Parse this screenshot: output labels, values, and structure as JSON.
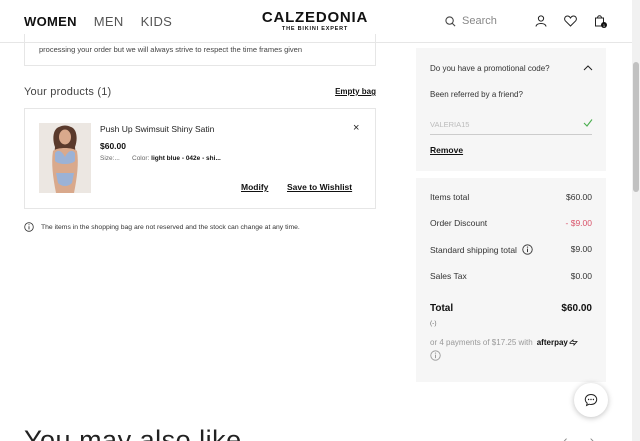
{
  "nav": {
    "items": [
      "WOMEN",
      "MEN",
      "KIDS"
    ]
  },
  "logo": {
    "main": "CALZEDONIA",
    "sub": "THE BIKINI EXPERT"
  },
  "header": {
    "search_placeholder": "Search"
  },
  "info_box": {
    "text": "processing your order but we will always strive to respect the time frames given"
  },
  "cart": {
    "title": "Your products (1)",
    "empty_bag_label": "Empty bag",
    "product": {
      "name": "Push Up Swimsuit Shiny Satin",
      "price": "$60.00",
      "size": "Size:...",
      "color_label": "Color:",
      "color_value": "light blue - 042e - shi...",
      "remove_symbol": "×",
      "modify_label": "Modify",
      "wishlist_label": "Save to Wishlist"
    },
    "notice": "The items in the shopping bag are not reserved and the stock can change at any time."
  },
  "promo": {
    "question": "Do you have a promotional code?",
    "referred": "Been referred by a friend?",
    "code_value": "VALERIA15",
    "remove_label": "Remove"
  },
  "summary": {
    "items_total_label": "Items total",
    "items_total_value": "$60.00",
    "discount_label": "Order Discount",
    "discount_value": "- $9.00",
    "shipping_label": "Standard shipping total",
    "shipping_value": "$9.00",
    "tax_label": "Sales Tax",
    "tax_value": "$0.00",
    "total_label": "Total",
    "total_value": "$60.00",
    "total_sub": "(-)",
    "afterpay_text": "or 4 payments of $17.25 with",
    "afterpay_brand": "afterpay"
  },
  "recommend": {
    "title": "You may also like"
  },
  "colors": {
    "discount": "#d9536a",
    "panel_bg": "#f6f6f6",
    "check": "#4caf50"
  }
}
